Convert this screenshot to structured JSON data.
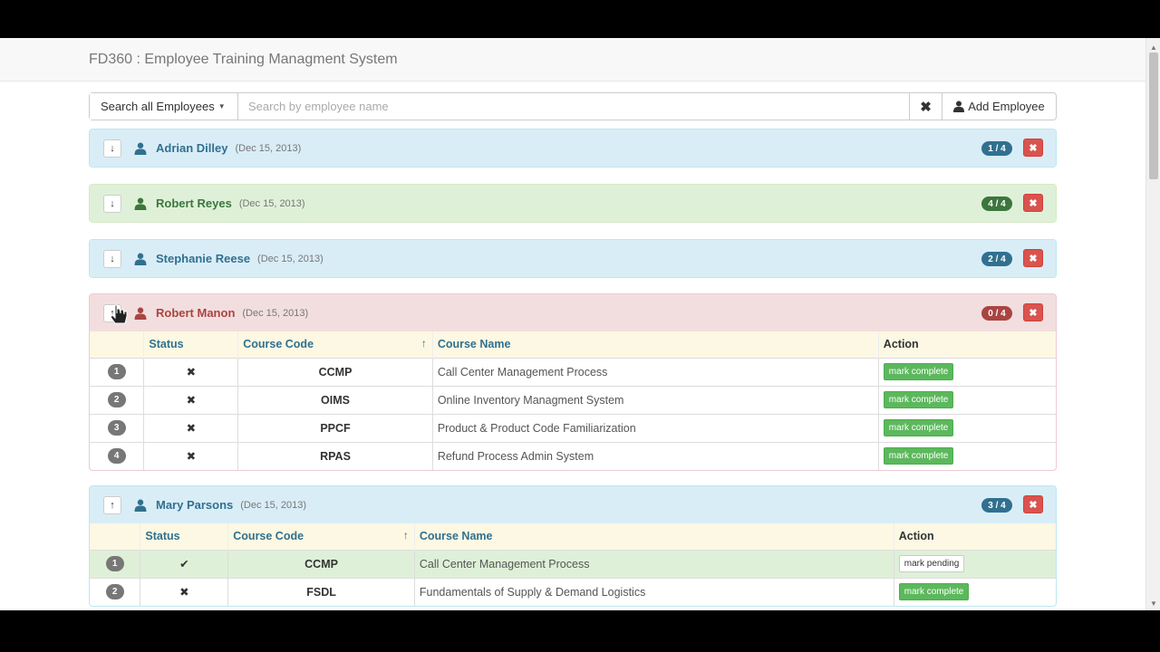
{
  "app": {
    "title": "FD360 : Employee Training Managment System"
  },
  "search": {
    "dropdown_label": "Search all Employees",
    "placeholder": "Search by employee name",
    "value": "",
    "clear_icon": "✖",
    "add_label": "Add Employee"
  },
  "table_headers": {
    "status": "Status",
    "course_code": "Course Code",
    "course_name": "Course Name",
    "action": "Action"
  },
  "employees": [
    {
      "name": "Adrian Dilley",
      "date": "(Dec 15, 2013)",
      "progress": "1 / 4",
      "state": "info",
      "toggle_icon": "↓",
      "expanded": false
    },
    {
      "name": "Robert Reyes",
      "date": "(Dec 15, 2013)",
      "progress": "4 / 4",
      "state": "success",
      "toggle_icon": "↓",
      "expanded": false
    },
    {
      "name": "Stephanie Reese",
      "date": "(Dec 15, 2013)",
      "progress": "2 / 4",
      "state": "info",
      "toggle_icon": "↓",
      "expanded": false
    },
    {
      "name": "Robert Manon",
      "date": "(Dec 15, 2013)",
      "progress": "0 / 4",
      "state": "danger",
      "toggle_icon": "↑",
      "expanded": true,
      "courses": [
        {
          "num": "1",
          "status": "✖",
          "code": "CCMP",
          "name": "Call Center Management Process",
          "action": "mark complete",
          "done": false
        },
        {
          "num": "2",
          "status": "✖",
          "code": "OIMS",
          "name": "Online Inventory Managment System",
          "action": "mark complete",
          "done": false
        },
        {
          "num": "3",
          "status": "✖",
          "code": "PPCF",
          "name": "Product & Product Code Familiarization",
          "action": "mark complete",
          "done": false
        },
        {
          "num": "4",
          "status": "✖",
          "code": "RPAS",
          "name": "Refund Process Admin System",
          "action": "mark complete",
          "done": false
        }
      ]
    },
    {
      "name": "Mary Parsons",
      "date": "(Dec 15, 2013)",
      "progress": "3 / 4",
      "state": "info",
      "toggle_icon": "↑",
      "expanded": true,
      "courses": [
        {
          "num": "1",
          "status": "✔",
          "code": "CCMP",
          "name": "Call Center Management Process",
          "action": "mark pending",
          "done": true
        },
        {
          "num": "2",
          "status": "✖",
          "code": "FSDL",
          "name": "Fundamentals of Supply & Demand Logistics",
          "action": "mark complete",
          "done": false
        }
      ]
    }
  ],
  "delete_icon": "✖",
  "sort_icon": "↑"
}
